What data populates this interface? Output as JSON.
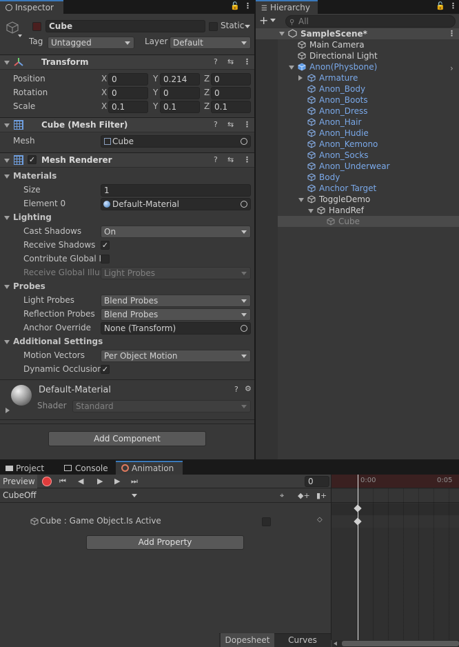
{
  "inspector": {
    "tab_label": "Inspector",
    "object_name": "Cube",
    "static_label": "Static",
    "tag_label": "Tag",
    "tag_value": "Untagged",
    "layer_label": "Layer",
    "layer_value": "Default",
    "transform": {
      "title": "Transform",
      "rows": [
        {
          "label": "Position",
          "x": "0",
          "y": "0.214",
          "z": "0"
        },
        {
          "label": "Rotation",
          "x": "0",
          "y": "0",
          "z": "0"
        },
        {
          "label": "Scale",
          "x": "0.1",
          "y": "0.1",
          "z": "0.1"
        }
      ],
      "axis_x": "X",
      "axis_y": "Y",
      "axis_z": "Z"
    },
    "mesh_filter": {
      "title": "Cube (Mesh Filter)",
      "mesh_label": "Mesh",
      "mesh_value": "Cube"
    },
    "mesh_renderer": {
      "title": "Mesh Renderer",
      "materials_label": "Materials",
      "size_label": "Size",
      "size_value": "1",
      "element0_label": "Element 0",
      "element0_value": "Default-Material",
      "lighting_label": "Lighting",
      "cast_shadows_label": "Cast Shadows",
      "cast_shadows_value": "On",
      "receive_shadows_label": "Receive Shadows",
      "contribute_gi_label": "Contribute Global Ill",
      "receive_gi_label": "Receive Global Illun",
      "receive_gi_value": "Light Probes",
      "probes_label": "Probes",
      "light_probes_label": "Light Probes",
      "light_probes_value": "Blend Probes",
      "reflection_probes_label": "Reflection Probes",
      "reflection_probes_value": "Blend Probes",
      "anchor_override_label": "Anchor Override",
      "anchor_override_value": "None (Transform)",
      "additional_label": "Additional Settings",
      "motion_vectors_label": "Motion Vectors",
      "motion_vectors_value": "Per Object Motion",
      "dynamic_occlusion_label": "Dynamic Occlusion"
    },
    "material": {
      "name": "Default-Material",
      "shader_label": "Shader",
      "shader_value": "Standard"
    },
    "add_component": "Add Component"
  },
  "hierarchy": {
    "tab_label": "Hierarchy",
    "search_placeholder": "All",
    "scene": "SampleScene*",
    "items": [
      {
        "label": "Main Camera"
      },
      {
        "label": "Directional Light"
      },
      {
        "label": "Anon(Physbone)"
      },
      {
        "label": "Armature"
      },
      {
        "label": "Anon_Body"
      },
      {
        "label": "Anon_Boots"
      },
      {
        "label": "Anon_Dress"
      },
      {
        "label": "Anon_Hair"
      },
      {
        "label": "Anon_Hudie"
      },
      {
        "label": "Anon_Kemono"
      },
      {
        "label": "Anon_Socks"
      },
      {
        "label": "Anon_Underwear"
      },
      {
        "label": "Body"
      },
      {
        "label": "Anchor Target"
      },
      {
        "label": "ToggleDemo"
      },
      {
        "label": "HandRef"
      },
      {
        "label": "Cube"
      }
    ]
  },
  "bottom": {
    "tabs": [
      "Project",
      "Console",
      "Animation"
    ],
    "preview_label": "Preview",
    "frame_value": "0",
    "clip_name": "CubeOff",
    "property_label": "Cube : Game Object.Is Active",
    "add_property": "Add Property",
    "timeline_t0": "0:00",
    "timeline_t1": "0:05",
    "dopesheet_label": "Dopesheet",
    "curves_label": "Curves"
  },
  "colors": {
    "accent": "#3a79bb",
    "record": "#e03c3c",
    "link_blue": "#7aa9ea"
  }
}
